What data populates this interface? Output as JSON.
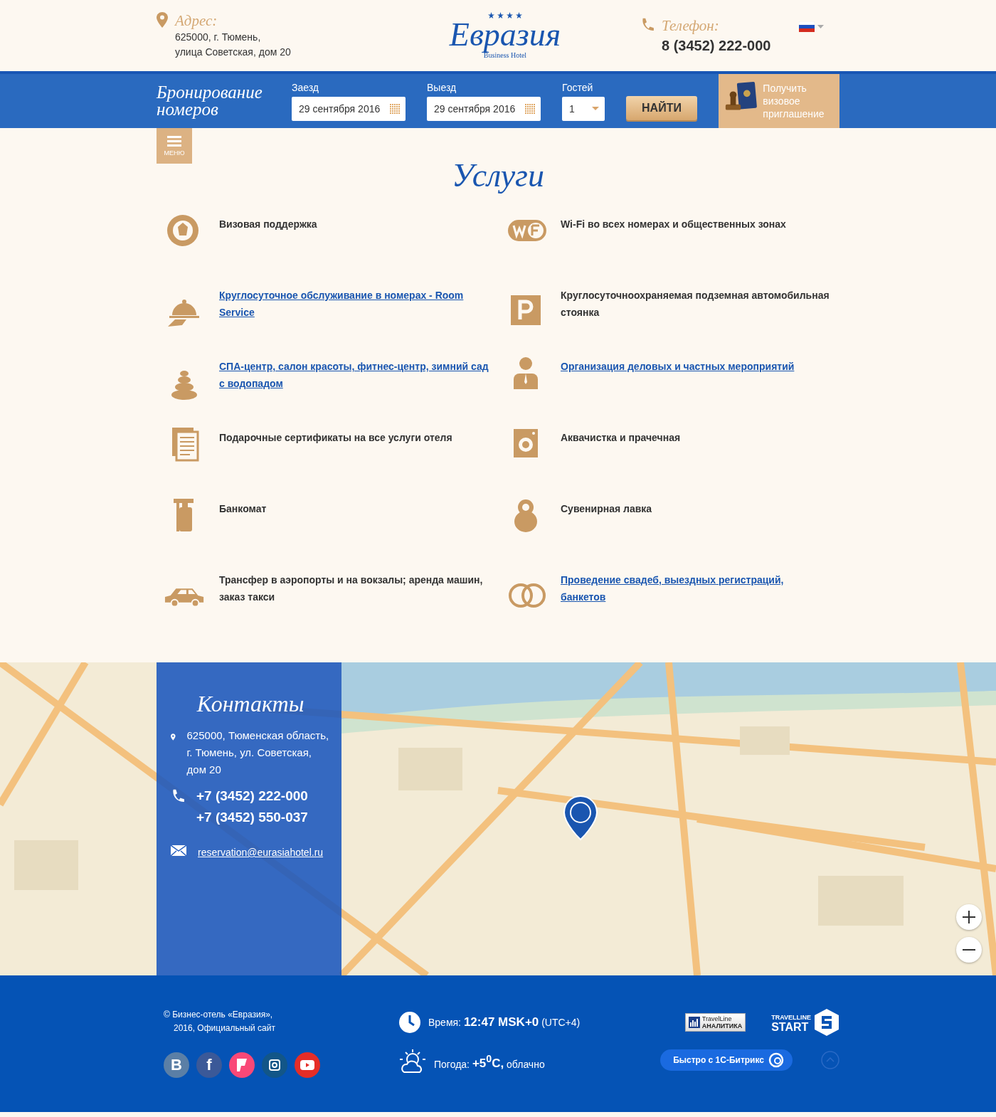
{
  "header": {
    "address_label": "Адрес:",
    "address_lines": [
      "625000, г. Тюмень,",
      "улица Советская, дом 20"
    ],
    "logo": {
      "name": "Евразия",
      "subtitle": "Business Hotel"
    },
    "phone_label": "Телефон:",
    "phone": "8 (3452) 222-000"
  },
  "booking": {
    "title_lines": [
      "Бронирование",
      "номеров"
    ],
    "fields": [
      {
        "kind": "date",
        "label": "Заезд",
        "value": "29 сентября 2016"
      },
      {
        "kind": "date",
        "label": "Выезд",
        "value": "29 сентября 2016"
      },
      {
        "kind": "select",
        "label": "Гостей",
        "value": "1"
      }
    ],
    "button": "НАЙТИ",
    "visa": "Получить визовое приглашение"
  },
  "menu_button": "МЕНЮ",
  "services": {
    "title": "Услуги",
    "items": [
      {
        "kind": "visa",
        "text": "Визовая поддержка",
        "link": false
      },
      {
        "kind": "wifi",
        "text": "Wi-Fi во всех номерах и общественных зонах",
        "link": false
      },
      {
        "kind": "roomservice",
        "text": "Круглосуточное обслуживание в номерах - Room Service ",
        "link": true
      },
      {
        "kind": "parking",
        "text": "Круглосуточноохраняемая подземная автомобильная стоянка",
        "link": false
      },
      {
        "kind": "spa",
        "text": "СПА-центр, салон красоты, фитнес-центр, зимний сад с водопадом ",
        "link": true
      },
      {
        "kind": "person",
        "text": "Организация деловых и частных мероприятий ",
        "link": true
      },
      {
        "kind": "document",
        "text": "Подарочные сертификаты на все услуги отеля",
        "link": false
      },
      {
        "kind": "laundry",
        "text": "Аквачистка и прачечная",
        "link": false
      },
      {
        "kind": "atm",
        "text": "Банкомат",
        "link": false
      },
      {
        "kind": "doll",
        "text": "Сувенирная лавка",
        "link": false
      },
      {
        "kind": "car",
        "text": "Трансфер в аэропорты и на вокзалы; аренда машин, заказ такси",
        "link": false
      },
      {
        "kind": "rings",
        "text": "Проведение свадеб, выездных регистраций, банкетов ",
        "link": true
      }
    ]
  },
  "contacts": {
    "title": "Контакты",
    "address": "625000, Тюменская область, г. Тюмень,  ул. Советская, дом 20",
    "phones": [
      "+7 (3452) 222-000",
      "+7 (3452) 550-037"
    ],
    "email": "reservation@eurasiahotel.ru"
  },
  "footer": {
    "copyright_lines": [
      "© Бизнес-отель «Евразия»,",
      "2016, Официальный сайт"
    ],
    "socials": [
      {
        "kind": "vk",
        "label": "B"
      },
      {
        "kind": "facebook",
        "label": "f"
      },
      {
        "kind": "foursquare"
      },
      {
        "kind": "instagram"
      },
      {
        "kind": "youtube"
      }
    ],
    "time": {
      "label": "Время:",
      "value": "12:47 MSK+0",
      "zone": "(UTC+4)"
    },
    "weather": {
      "label": "Погода:",
      "value": "+5$^{0}$C,",
      "text": "облачно"
    },
    "analytics_badge": [
      "TravelLine",
      "АНАЛИТИКА"
    ],
    "start_badge": [
      "TRAVELLINE",
      "START"
    ],
    "bitrix_badge": "Быстро с 1С-Битрикс"
  }
}
